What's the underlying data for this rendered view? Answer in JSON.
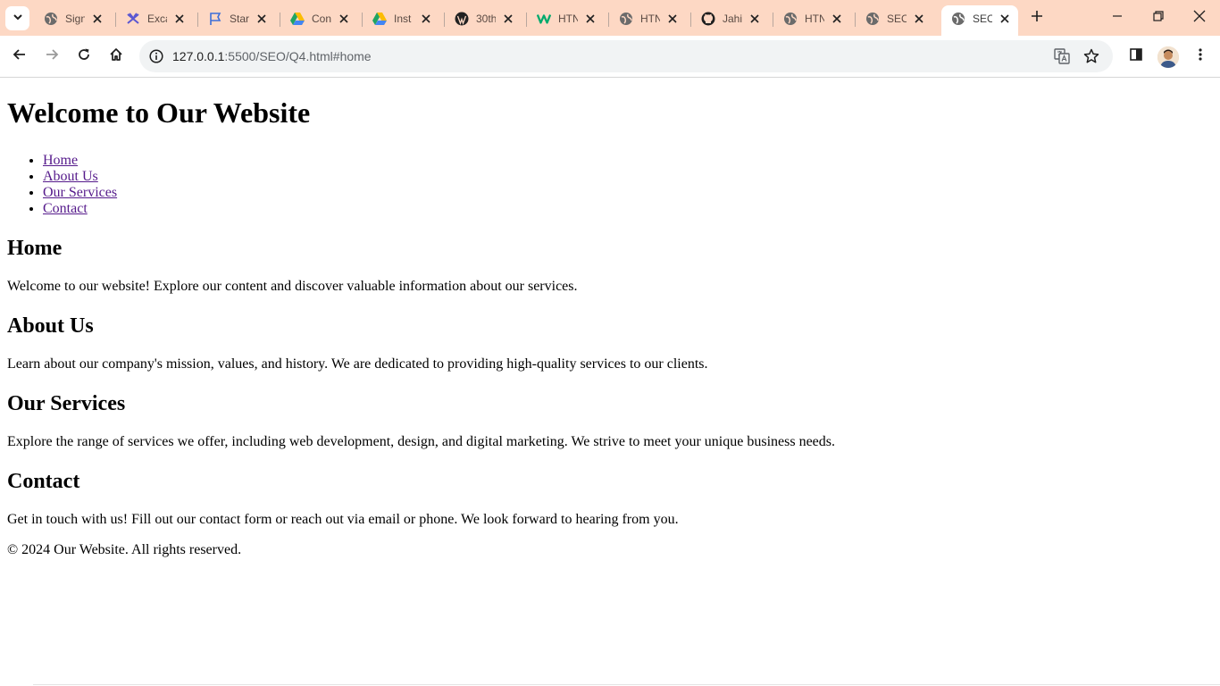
{
  "browser": {
    "tabs": [
      {
        "title": "Sign",
        "icon": "globe-icon"
      },
      {
        "title": "Exca",
        "icon": "excalidraw-icon"
      },
      {
        "title": "Star",
        "icon": "flag-icon"
      },
      {
        "title": "Con",
        "icon": "google-drive-icon"
      },
      {
        "title": "Inst",
        "icon": "google-drive-icon"
      },
      {
        "title": "30th",
        "icon": "wordpress-icon"
      },
      {
        "title": "HTN",
        "icon": "w-logo-icon"
      },
      {
        "title": "HTN",
        "icon": "globe-icon"
      },
      {
        "title": "Jahi",
        "icon": "github-icon"
      },
      {
        "title": "HTN",
        "icon": "globe-icon"
      },
      {
        "title": "SEO",
        "icon": "globe-icon"
      },
      {
        "title": "SEO",
        "icon": "globe-icon",
        "active": true
      }
    ],
    "address": {
      "host": "127.0.0.1",
      "rest": ":5500/SEO/Q4.html#home"
    },
    "colors": {
      "tabstrip": "#fdd8c4",
      "omnibox": "#f1f3f4",
      "link_visited": "#551a8b"
    }
  },
  "page": {
    "title": "Welcome to Our Website",
    "nav": [
      {
        "label": "Home"
      },
      {
        "label": "About Us"
      },
      {
        "label": "Our Services"
      },
      {
        "label": "Contact"
      }
    ],
    "sections": {
      "home": {
        "heading": "Home",
        "text": "Welcome to our website! Explore our content and discover valuable information about our services."
      },
      "about": {
        "heading": "About Us",
        "text": "Learn about our company's mission, values, and history. We are dedicated to providing high-quality services to our clients."
      },
      "services": {
        "heading": "Our Services",
        "text": "Explore the range of services we offer, including web development, design, and digital marketing. We strive to meet your unique business needs."
      },
      "contact": {
        "heading": "Contact",
        "text": "Get in touch with us! Fill out our contact form or reach out via email or phone. We look forward to hearing from you."
      }
    },
    "footer": "© 2024 Our Website. All rights reserved."
  }
}
